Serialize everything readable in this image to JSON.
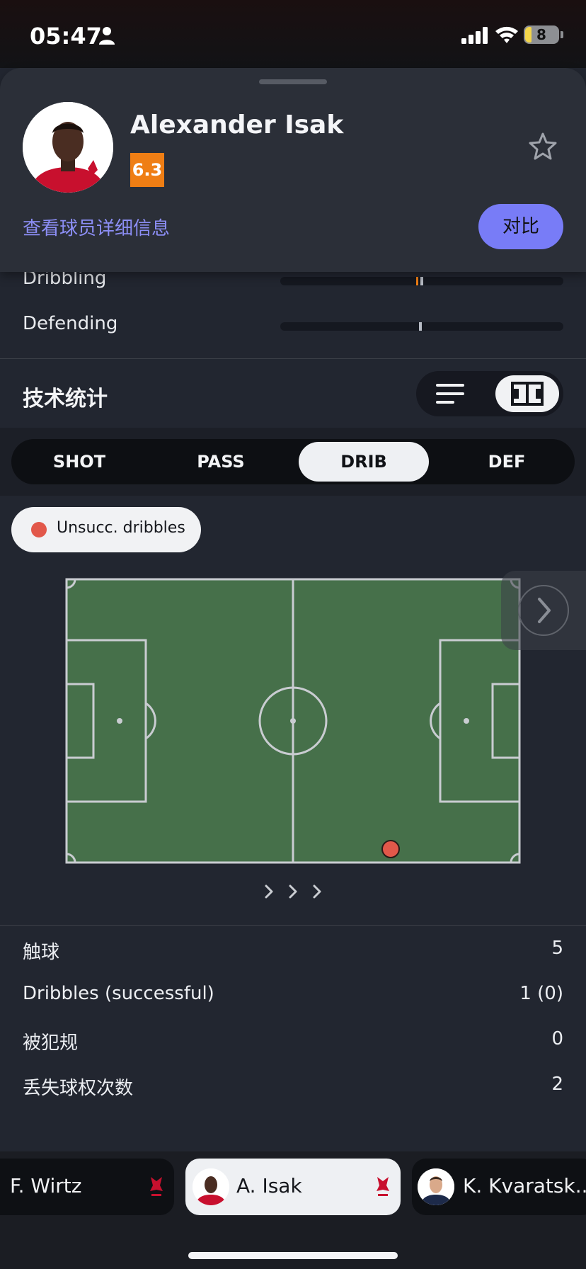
{
  "status_bar": {
    "time": "05:47",
    "battery": "8"
  },
  "header": {
    "player_name": "Alexander Isak",
    "rating": "6.3",
    "details_link": "查看球员详细信息",
    "compare_label": "对比"
  },
  "attributes": [
    {
      "label": "Dribbling"
    },
    {
      "label": "Defending"
    }
  ],
  "section": {
    "title": "技术统计"
  },
  "tabs": [
    {
      "label": "SHOT",
      "active": false
    },
    {
      "label": "PASS",
      "active": false
    },
    {
      "label": "DRIB",
      "active": true
    },
    {
      "label": "DEF",
      "active": false
    }
  ],
  "legend": {
    "label": "Unsucc. dribbles",
    "color": "#e2584a"
  },
  "stats": [
    {
      "label": "触球",
      "value": "5"
    },
    {
      "label": "Dribbles (successful)",
      "value": "1 (0)"
    },
    {
      "label": "被犯规",
      "value": "0"
    },
    {
      "label": "丢失球权次数",
      "value": "2"
    }
  ],
  "player_strip": [
    {
      "name": "F. Wirtz",
      "active": false
    },
    {
      "name": "A. Isak",
      "active": true
    },
    {
      "name": "K. Kvaratsk...",
      "active": false
    }
  ],
  "colors": {
    "accent": "#787cf7",
    "rating": "#ef7e14",
    "pitch": "#46704a"
  }
}
